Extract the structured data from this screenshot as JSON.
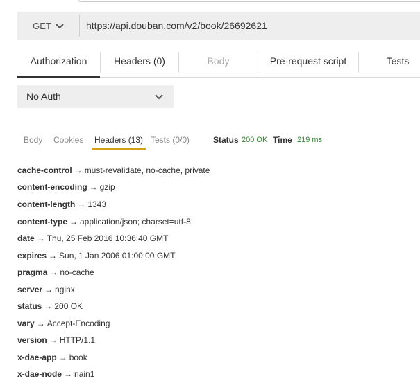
{
  "request": {
    "method": "GET",
    "url": "https://api.douban.com/v2/book/26692621"
  },
  "request_tabs": [
    {
      "label": "Authorization",
      "active": true,
      "disabled": false
    },
    {
      "label": "Headers (0)",
      "active": false,
      "disabled": false
    },
    {
      "label": "Body",
      "active": false,
      "disabled": true
    },
    {
      "label": "Pre-request script",
      "active": false,
      "disabled": false
    },
    {
      "label": "Tests",
      "active": false,
      "disabled": false
    }
  ],
  "auth": {
    "selected": "No Auth"
  },
  "response_tabs": [
    {
      "label": "Body",
      "active": false
    },
    {
      "label": "Cookies",
      "active": false
    },
    {
      "label": "Headers (13)",
      "active": true
    },
    {
      "label": "Tests (0/0)",
      "active": false
    }
  ],
  "response_meta": {
    "status_label": "Status",
    "status_value": "200 OK",
    "time_label": "Time",
    "time_value": "219 ms"
  },
  "arrow": "→",
  "headers": [
    {
      "key": "cache-control",
      "value": "must-revalidate, no-cache, private"
    },
    {
      "key": "content-encoding",
      "value": "gzip"
    },
    {
      "key": "content-length",
      "value": "1343"
    },
    {
      "key": "content-type",
      "value": "application/json; charset=utf-8"
    },
    {
      "key": "date",
      "value": "Thu, 25 Feb 2016 10:36:40 GMT"
    },
    {
      "key": "expires",
      "value": "Sun, 1 Jan 2006 01:00:00 GMT"
    },
    {
      "key": "pragma",
      "value": "no-cache"
    },
    {
      "key": "server",
      "value": "nginx"
    },
    {
      "key": "status",
      "value": "200 OK"
    },
    {
      "key": "vary",
      "value": "Accept-Encoding"
    },
    {
      "key": "version",
      "value": "HTTP/1.1"
    },
    {
      "key": "x-dae-app",
      "value": "book"
    },
    {
      "key": "x-dae-node",
      "value": "nain1"
    }
  ],
  "colors": {
    "ok": "#2e8b2e",
    "active_underline": "#d4a017"
  }
}
